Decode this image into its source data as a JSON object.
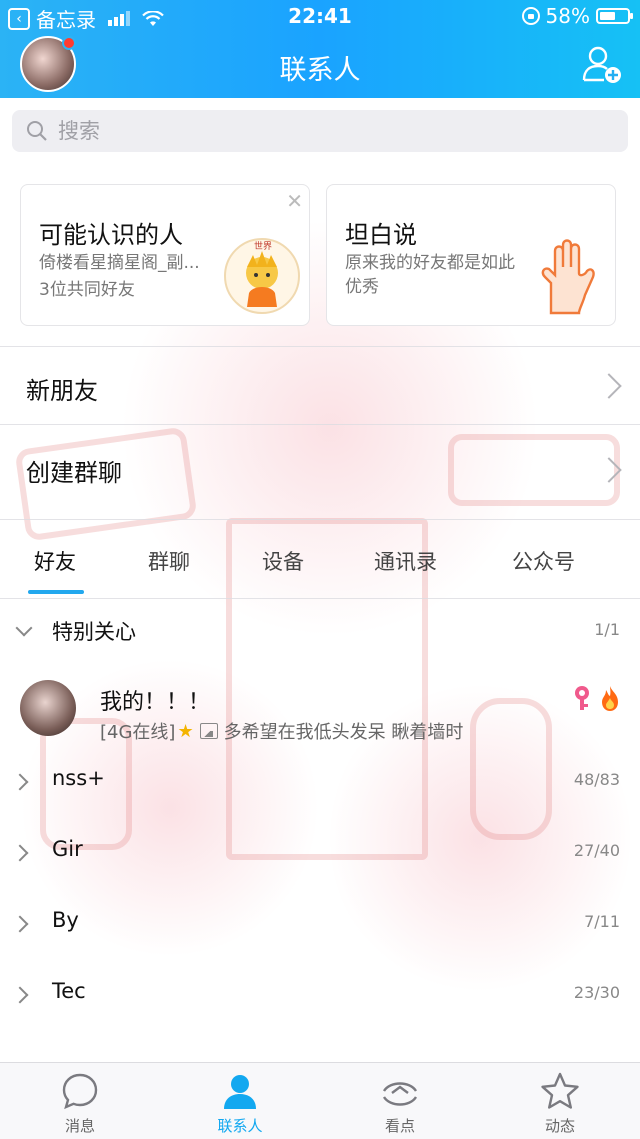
{
  "status_bar": {
    "back_app": "备忘录",
    "time": "22:41",
    "battery": "58%",
    "battery_level": 0.58
  },
  "header": {
    "title": "联系人"
  },
  "search": {
    "placeholder": "搜索"
  },
  "cards": [
    {
      "title": "可能认识的人",
      "subtitle": "倚楼看星摘星阁_副...",
      "detail": "3位共同好友",
      "thumb_text": "世界"
    },
    {
      "title": "坦白说",
      "subtitle": "原来我的好友都是如此优秀"
    }
  ],
  "rows": {
    "new_friends": "新朋友",
    "create_group": "创建群聊"
  },
  "tabs": [
    "好友",
    "群聊",
    "设备",
    "通讯录",
    "公众号"
  ],
  "special": {
    "name": "特别关心",
    "count": "1/1"
  },
  "contact": {
    "name": "我的！！！",
    "status_prefix": "[4G在线]",
    "signature": "多希望在我低头发呆 瞅着墙时"
  },
  "groups": [
    {
      "name": "nss+",
      "count": "48/83"
    },
    {
      "name": "Gir",
      "count": "27/40"
    },
    {
      "name": "By",
      "count": "7/11"
    },
    {
      "name": "Tec",
      "count": "23/30"
    }
  ],
  "tabbar": [
    {
      "label": "消息",
      "icon": "message-icon"
    },
    {
      "label": "联系人",
      "icon": "contacts-icon"
    },
    {
      "label": "看点",
      "icon": "discover-icon"
    },
    {
      "label": "动态",
      "icon": "star-icon"
    }
  ],
  "colors": {
    "accent": "#12a8f0",
    "header_start": "#2bb3f5",
    "header_end": "#16c1f5"
  }
}
